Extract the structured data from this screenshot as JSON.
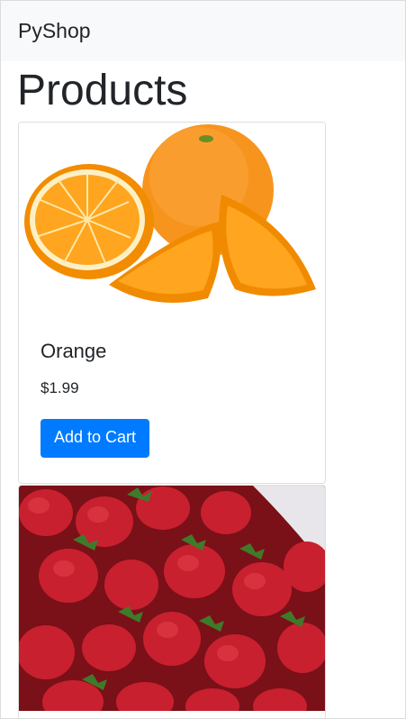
{
  "navbar": {
    "brand": "PyShop"
  },
  "page": {
    "title": "Products"
  },
  "products": [
    {
      "name": "Orange",
      "price": "$1.99",
      "button_label": "Add to Cart",
      "image": "orange-photo"
    },
    {
      "image": "strawberries-photo"
    }
  ],
  "colors": {
    "navbar_bg": "#f8f9fa",
    "primary_button": "#007bff",
    "text": "#212529"
  }
}
